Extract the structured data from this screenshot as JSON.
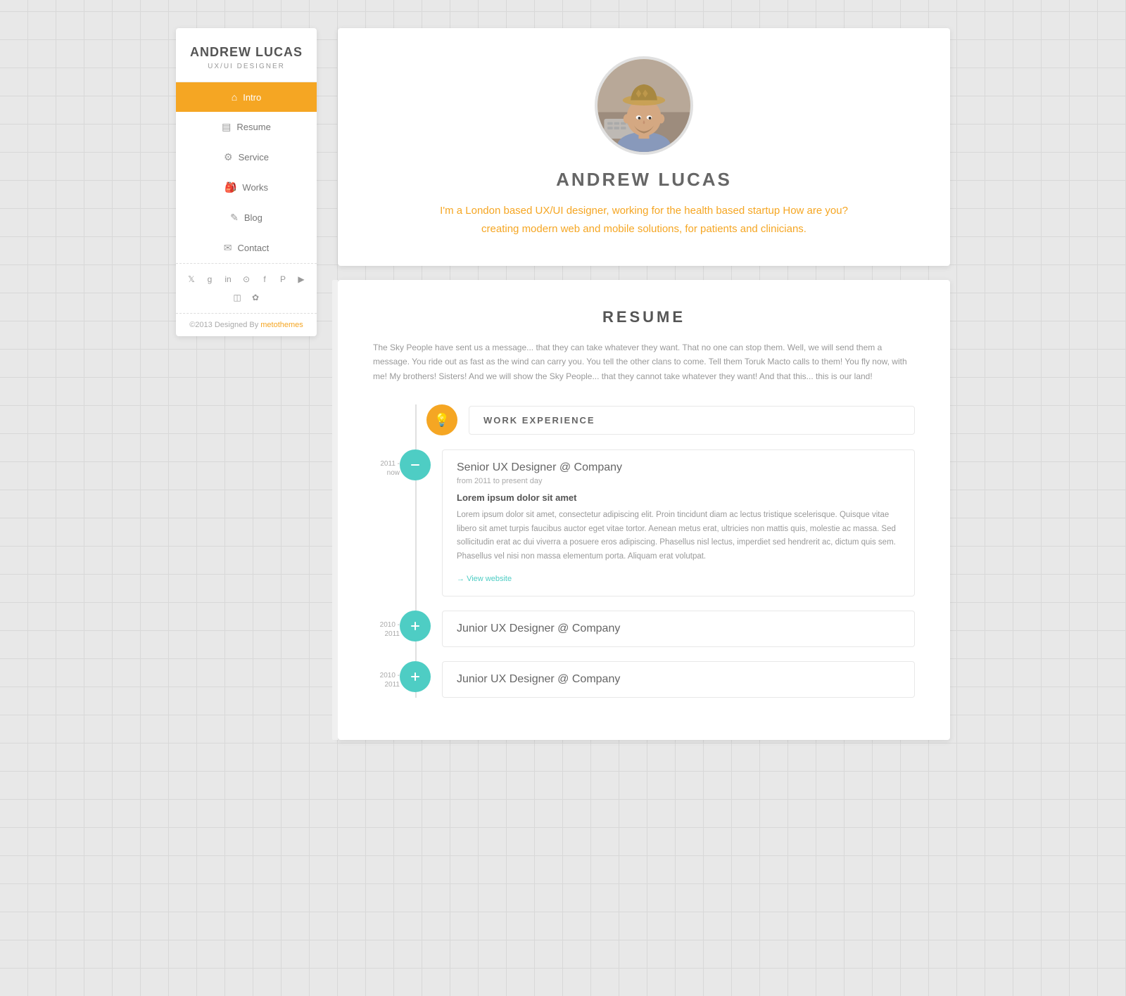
{
  "sidebar": {
    "name": "ANDREW LUCAS",
    "title": "UX/UI DESIGNER",
    "nav": [
      {
        "id": "intro",
        "label": "Intro",
        "icon": "🏠",
        "active": true
      },
      {
        "id": "resume",
        "label": "Resume",
        "icon": "📋",
        "active": false
      },
      {
        "id": "service",
        "label": "Service",
        "icon": "⚙️",
        "active": false
      },
      {
        "id": "works",
        "label": "Works",
        "icon": "💼",
        "active": false
      },
      {
        "id": "blog",
        "label": "Blog",
        "icon": "✏️",
        "active": false
      },
      {
        "id": "contact",
        "label": "Contact",
        "icon": "✉️",
        "active": false
      }
    ],
    "social_icons": [
      "𝕏",
      "g+",
      "in",
      "⊙",
      "f",
      "𝐏",
      "▶",
      "📷",
      "✿"
    ],
    "footer_text": "©2013 Designed By ",
    "footer_link": "metothemes",
    "footer_link_href": "#"
  },
  "intro": {
    "name": "ANDREW LUCAS",
    "bio": "I'm a London based UX/UI designer, working for the health based startup How are you? creating modern web and mobile solutions, for patients and clinicians."
  },
  "resume": {
    "title": "RESUME",
    "intro": "The Sky People have sent us a message... that they can take whatever they want. That no one can stop them. Well, we will send them a message. You ride out as fast as the wind can carry you. You tell the other clans to come. Tell them Toruk Macto calls to them! You fly now, with me! My brothers! Sisters! And we will show the Sky People... that they cannot take whatever they want! And that this... this is our land!",
    "sections": [
      {
        "type": "header",
        "label": "WORK EXPERIENCE",
        "icon": "💡",
        "icon_class": "icon-orange"
      },
      {
        "type": "entry",
        "years": "2011 - now",
        "icon": "➖",
        "icon_class": "icon-teal",
        "title": "Senior UX Designer @ Company",
        "period": "from 2011 to present day",
        "subtitle": "Lorem ipsum dolor sit amet",
        "description": "Lorem ipsum dolor sit amet, consectetur adipiscing elit. Proin tincidunt diam ac lectus tristique scelerisque. Quisque vitae libero sit amet turpis faucibus auctor eget vitae tortor. Aenean metus erat, ultricies non mattis quis, molestie ac massa. Sed sollicitudin erat ac dui viverra a posuere eros adipiscing. Phasellus nisl lectus, imperdiet sed hendrerit ac, dictum quis sem. Phasellus vel nisi non massa elementum porta. Aliquam erat volutpat.",
        "link_label": "View website"
      },
      {
        "type": "entry-collapsed",
        "years": "2010 - 2011",
        "icon": "➕",
        "icon_class": "icon-teal",
        "title": "Junior UX Designer @ Company"
      },
      {
        "type": "entry-collapsed",
        "years": "2010 - 2011",
        "icon": "➕",
        "icon_class": "icon-teal",
        "title": "Junior UX Designer @ Company"
      }
    ]
  }
}
